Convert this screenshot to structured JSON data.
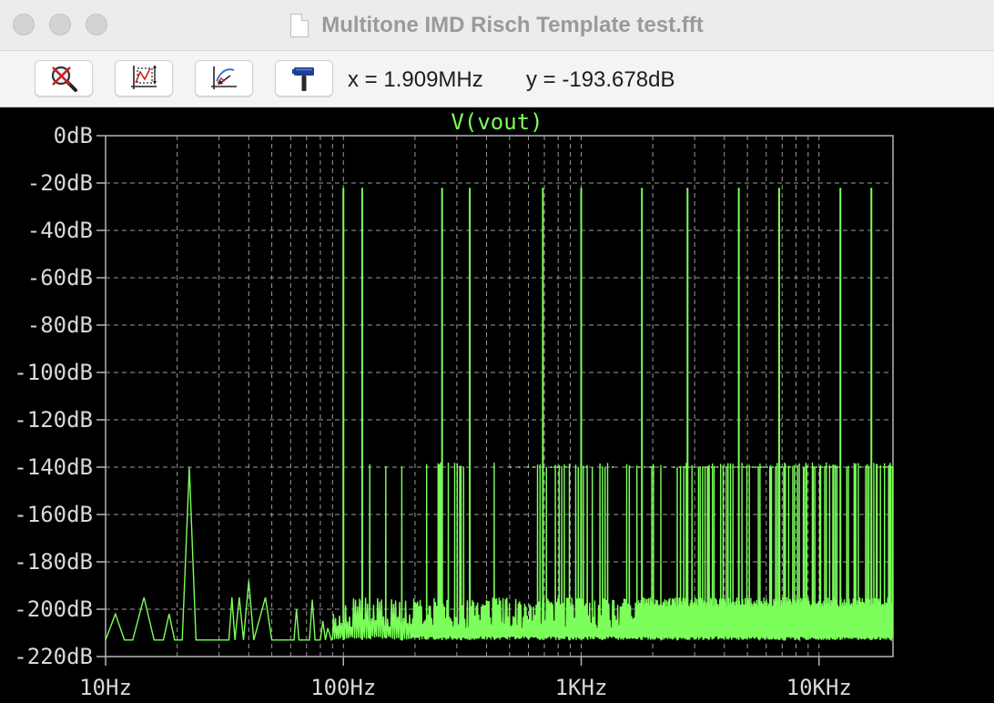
{
  "window": {
    "title": "Multitone IMD Risch Template test.fft"
  },
  "toolbar": {
    "buttons": [
      {
        "name": "zoom-cancel-button",
        "icon": "zoom-cancel-icon"
      },
      {
        "name": "autorange-button",
        "icon": "autorange-icon"
      },
      {
        "name": "zoom-back-button",
        "icon": "zoom-back-icon"
      },
      {
        "name": "settings-button",
        "icon": "hammer-icon"
      }
    ],
    "cursor_x": "x = 1.909MHz",
    "cursor_y": "y = -193.678dB"
  },
  "colors": {
    "trace": "#7cff5a",
    "grid": "#9a9a9a",
    "axis_text": "#d8d8d8",
    "background": "#000000"
  },
  "chart_data": {
    "type": "line",
    "title": "V(vout)",
    "x_scale": "log",
    "xlim_hz": [
      10,
      20000
    ],
    "ylim_db": [
      -220,
      0
    ],
    "y_ticks": [
      0,
      -20,
      -40,
      -60,
      -80,
      -100,
      -120,
      -140,
      -160,
      -180,
      -200,
      -220
    ],
    "y_tick_labels": [
      "0dB",
      "-20dB",
      "-40dB",
      "-60dB",
      "-80dB",
      "-100dB",
      "-120dB",
      "-140dB",
      "-160dB",
      "-180dB",
      "-200dB",
      "-220dB"
    ],
    "x_ticks": [
      10,
      100,
      1000,
      10000
    ],
    "x_tick_labels": [
      "10Hz",
      "100Hz",
      "1KHz",
      "10KHz"
    ],
    "grid": true,
    "noise_floor_db": [
      -213,
      -195
    ],
    "spur_level_db": -140,
    "tones": [
      {
        "f_hz": 100,
        "db": -22
      },
      {
        "f_hz": 120,
        "db": -22
      },
      {
        "f_hz": 260,
        "db": -22
      },
      {
        "f_hz": 340,
        "db": -22
      },
      {
        "f_hz": 690,
        "db": -22
      },
      {
        "f_hz": 1000,
        "db": -22
      },
      {
        "f_hz": 1800,
        "db": -22
      },
      {
        "f_hz": 2800,
        "db": -22
      },
      {
        "f_hz": 4600,
        "db": -22
      },
      {
        "f_hz": 6800,
        "db": -22
      },
      {
        "f_hz": 12300,
        "db": -22
      },
      {
        "f_hz": 16600,
        "db": -22
      }
    ],
    "low_freq_points": [
      {
        "f_hz": 10,
        "db": -213
      },
      {
        "f_hz": 11,
        "db": -202
      },
      {
        "f_hz": 12,
        "db": -213
      },
      {
        "f_hz": 13,
        "db": -213
      },
      {
        "f_hz": 14.5,
        "db": -195
      },
      {
        "f_hz": 16,
        "db": -213
      },
      {
        "f_hz": 17.5,
        "db": -213
      },
      {
        "f_hz": 18.5,
        "db": -202
      },
      {
        "f_hz": 19.5,
        "db": -213
      },
      {
        "f_hz": 21,
        "db": -213
      },
      {
        "f_hz": 22.5,
        "db": -140
      },
      {
        "f_hz": 24,
        "db": -213
      },
      {
        "f_hz": 33,
        "db": -213
      },
      {
        "f_hz": 34,
        "db": -195
      },
      {
        "f_hz": 35,
        "db": -213
      },
      {
        "f_hz": 36.5,
        "db": -195
      },
      {
        "f_hz": 38,
        "db": -213
      },
      {
        "f_hz": 40,
        "db": -188
      },
      {
        "f_hz": 42,
        "db": -213
      },
      {
        "f_hz": 47,
        "db": -195
      },
      {
        "f_hz": 50,
        "db": -213
      },
      {
        "f_hz": 62,
        "db": -213
      },
      {
        "f_hz": 63.5,
        "db": -200
      },
      {
        "f_hz": 65,
        "db": -213
      },
      {
        "f_hz": 72,
        "db": -213
      },
      {
        "f_hz": 74,
        "db": -196
      },
      {
        "f_hz": 76,
        "db": -213
      },
      {
        "f_hz": 80,
        "db": -213
      },
      {
        "f_hz": 82,
        "db": -205
      },
      {
        "f_hz": 84,
        "db": -213
      },
      {
        "f_hz": 86,
        "db": -208
      },
      {
        "f_hz": 89,
        "db": -213
      }
    ]
  }
}
